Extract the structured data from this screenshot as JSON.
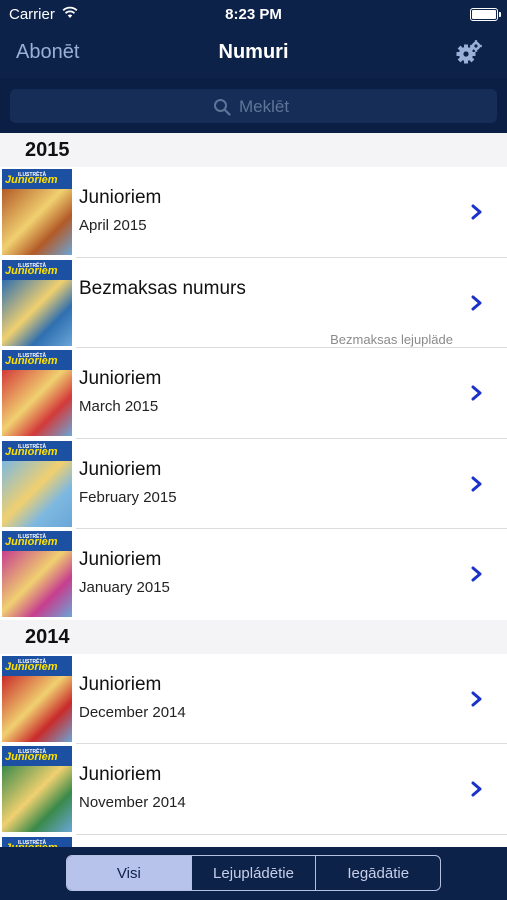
{
  "status_bar": {
    "carrier": "Carrier",
    "time": "8:23 PM"
  },
  "nav": {
    "back_label": "Abonēt",
    "title": "Numuri",
    "settings_icon": "gear-icon"
  },
  "search": {
    "placeholder": "Meklēt",
    "icon": "search-icon"
  },
  "sections": [
    {
      "year": "2015",
      "items": [
        {
          "title": "Junioriem",
          "subtitle": "April 2015",
          "note": "",
          "cover_color": "#b35a28"
        },
        {
          "title": "Bezmaksas numurs",
          "subtitle": "",
          "note": "Bezmaksas lejupläde",
          "cover_color": "#2f6fb0"
        },
        {
          "title": "Junioriem",
          "subtitle": "March 2015",
          "note": "",
          "cover_color": "#d33a3a"
        },
        {
          "title": "Junioriem",
          "subtitle": "February 2015",
          "note": "",
          "cover_color": "#7db8e0"
        },
        {
          "title": "Junioriem",
          "subtitle": "January 2015",
          "note": "",
          "cover_color": "#c63e8e"
        }
      ]
    },
    {
      "year": "2014",
      "items": [
        {
          "title": "Junioriem",
          "subtitle": "December 2014",
          "note": "",
          "cover_color": "#c92b2b"
        },
        {
          "title": "Junioriem",
          "subtitle": "November 2014",
          "note": "",
          "cover_color": "#3a8a4a"
        },
        {
          "title": "",
          "subtitle": "",
          "note": "",
          "cover_color": "#4a7cc0"
        }
      ]
    }
  ],
  "cover_masthead": "Junioriem",
  "cover_kicker": "ILUSTRĒTĀ",
  "segments": [
    {
      "label": "Visi",
      "active": true
    },
    {
      "label": "Lejupládētie",
      "active": false
    },
    {
      "label": "Iegādātie",
      "active": false
    }
  ],
  "colors": {
    "bar_background": "#0d2248",
    "accent_chevron": "#1a32c8",
    "segment_active": "#b8c3ec"
  }
}
